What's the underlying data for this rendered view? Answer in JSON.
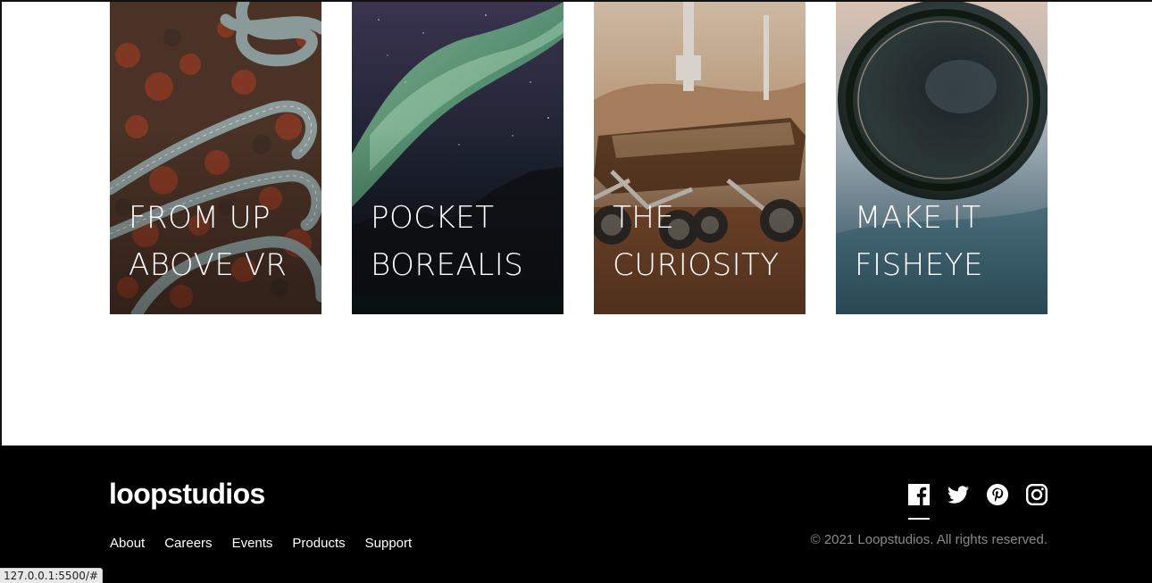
{
  "cards": [
    {
      "line1": "FROM UP",
      "line2": "ABOVE VR"
    },
    {
      "line1": "POCKET",
      "line2": "BOREALIS"
    },
    {
      "line1": "THE",
      "line2": "CURIOSITY"
    },
    {
      "line1": "MAKE IT",
      "line2": "FISHEYE"
    }
  ],
  "footer": {
    "logo": "loopstudios",
    "nav": [
      "About",
      "Careers",
      "Events",
      "Products",
      "Support"
    ],
    "copyright": "© 2021 Loopstudios. All rights reserved.",
    "socials": [
      "facebook-icon",
      "twitter-icon",
      "pinterest-icon",
      "instagram-icon"
    ]
  },
  "status_bar": {
    "url": "127.0.0.1:5500/#"
  },
  "colors": {
    "footer_bg": "#000000",
    "page_bg": "#ffffff",
    "copyright": "#8a8a8a"
  }
}
